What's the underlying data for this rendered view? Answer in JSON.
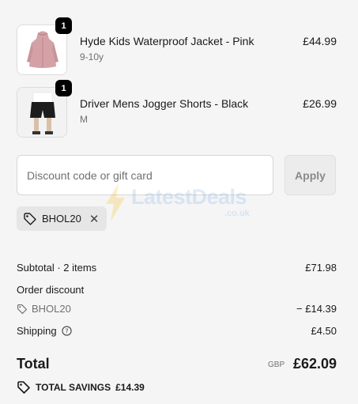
{
  "items": [
    {
      "name": "Hyde Kids Waterproof Jacket - Pink",
      "variant": "9-10y",
      "price": "£44.99",
      "quantity": "1",
      "image_icon": "pink-jacket-image",
      "color": "#d3a1a6"
    },
    {
      "name": "Driver Mens Jogger Shorts - Black",
      "variant": "M",
      "price": "£26.99",
      "quantity": "1",
      "image_icon": "black-shorts-image",
      "color": "#1d1d1d"
    }
  ],
  "discount": {
    "placeholder": "Discount code or gift card",
    "value": "",
    "apply_label": "Apply",
    "applied_code": "BHOL20",
    "tag_icon": "tag-icon",
    "remove_icon": "close-icon"
  },
  "watermark": {
    "text": "LatestDeals",
    "sub": ".co.uk",
    "icon": "lightning-icon"
  },
  "summary": {
    "subtotal_label": "Subtotal · 2 items",
    "subtotal_value": "£71.98",
    "order_discount_label": "Order discount",
    "discount_code": "BHOL20",
    "discount_value": "− £14.39",
    "shipping_label": "Shipping",
    "shipping_value": "£4.50",
    "shipping_help_icon": "help-circle-icon",
    "total_label": "Total",
    "total_currency": "GBP",
    "total_value": "£62.09",
    "savings_label": "TOTAL SAVINGS",
    "savings_value": "£14.39"
  },
  "colors": {
    "accent_text": "#1a1a1a",
    "muted": "#707070",
    "badge": "#000000"
  }
}
